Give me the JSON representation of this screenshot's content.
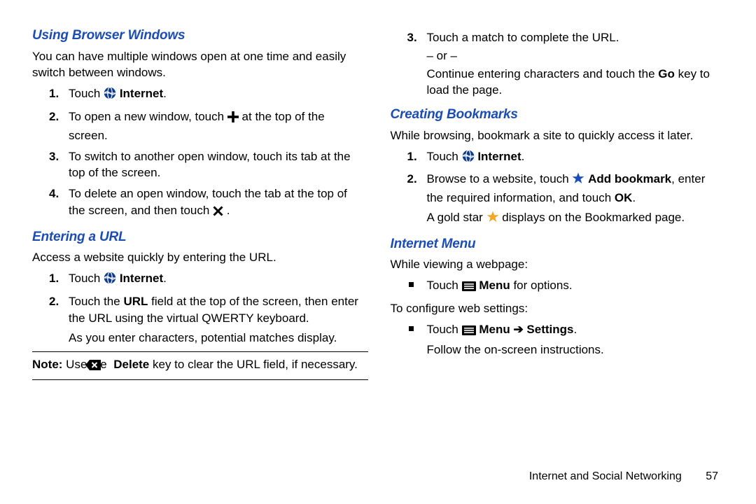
{
  "sec1": {
    "heading": "Using Browser Windows",
    "intro": "You can have multiple windows open at one time and easily switch between windows.",
    "s1a": "Touch ",
    "s1b": "Internet",
    "s1c": ".",
    "s2a": "To open a new window, touch ",
    "s2b": " at the top of the screen.",
    "s3": "To switch to another open window, touch its tab at the top of the screen.",
    "s4a": "To delete an open window, touch the tab at the top of the screen, and then touch ",
    "s4b": " ."
  },
  "sec2": {
    "heading": "Entering a URL",
    "intro": "Access a website quickly by entering the URL.",
    "s1a": "Touch ",
    "s1b": "Internet",
    "s1c": ".",
    "s2a": "Touch the ",
    "s2b": "URL",
    "s2c": " field at the top of the screen, then enter the URL using the virtual QWERTY keyboard.",
    "s2d": "As you enter characters, potential matches display.",
    "note_a": "Note:",
    "note_b": " Use the ",
    "note_c": "Delete",
    "note_d": " key to clear the URL field, if necessary.",
    "s3a": "Touch a match to complete the URL.",
    "s3or": "– or –",
    "s3b": "Continue entering characters and touch the ",
    "s3c": "Go",
    "s3d": " key to load the page."
  },
  "sec3": {
    "heading": "Creating Bookmarks",
    "intro": "While browsing, bookmark a site to quickly access it later.",
    "s1a": "Touch ",
    "s1b": "Internet",
    "s1c": ".",
    "s2a": "Browse to a website, touch ",
    "s2b": "Add bookmark",
    "s2c": ", enter the required information, and touch ",
    "s2d": "OK",
    "s2e": ".",
    "s2f": "A gold star ",
    "s2g": " displays on the Bookmarked page."
  },
  "sec4": {
    "heading": "Internet Menu",
    "l1": "While viewing a webpage:",
    "b1a": "Touch ",
    "b1b": "Menu",
    "b1c": " for options.",
    "l2": "To configure web settings:",
    "b2a": "Touch ",
    "b2b": "Menu",
    "b2arrow": " ➔ ",
    "b2c": "Settings",
    "b2d": ".",
    "b2e": "Follow the on-screen instructions."
  },
  "footer": {
    "chapter": "Internet and Social Networking",
    "page": "57"
  }
}
